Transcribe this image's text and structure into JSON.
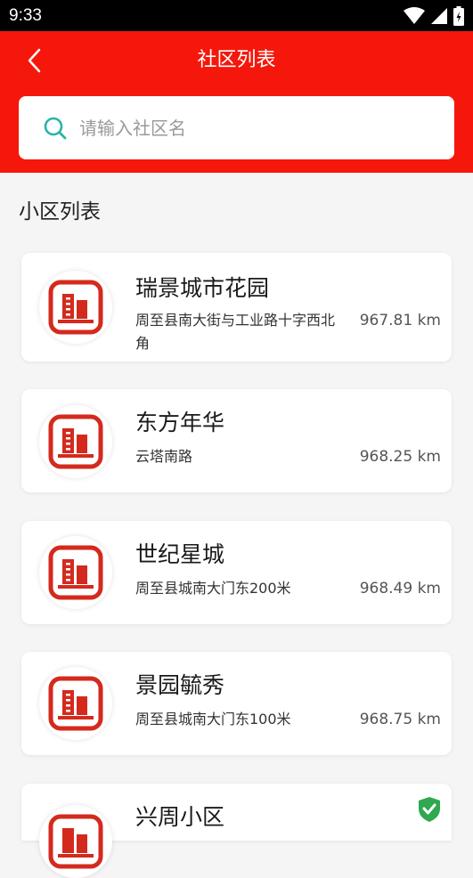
{
  "status_bar": {
    "time": "9:33"
  },
  "header": {
    "title": "社区列表"
  },
  "search": {
    "placeholder": "请输入社区名"
  },
  "section": {
    "title": "小区列表"
  },
  "colors": {
    "brand_red": "#f5170b",
    "search_icon": "#2ab3a6",
    "shield_green": "#2fa84f"
  },
  "communities": [
    {
      "name": "瑞景城市花园",
      "address": "周至县南大街与工业路十字西北角",
      "distance": "967.81 km"
    },
    {
      "name": "东方年华",
      "address": "云塔南路",
      "distance": "968.25 km"
    },
    {
      "name": "世纪星城",
      "address": "周至县城南大门东200米",
      "distance": "968.49 km"
    },
    {
      "name": "景园毓秀",
      "address": "周至县城南大门东100米",
      "distance": "968.75 km"
    },
    {
      "name": "兴周小区",
      "address": "",
      "distance": ""
    }
  ],
  "icons": {
    "back": "chevron-left-icon",
    "search": "search-icon",
    "community": "building-icon",
    "verified": "shield-check-icon"
  }
}
